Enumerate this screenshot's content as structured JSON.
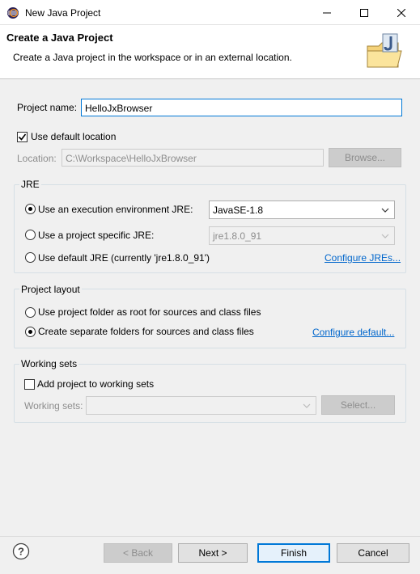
{
  "window": {
    "title": "New Java Project",
    "icon": "eclipse-icon"
  },
  "banner": {
    "title": "Create a Java Project",
    "description": "Create a Java project in the workspace or in an external location.",
    "icon": "java-project-wizard-icon"
  },
  "project_name": {
    "label": "Project name:",
    "value": "HelloJxBrowser"
  },
  "location": {
    "use_default_label": "Use default location",
    "use_default_checked": true,
    "label": "Location:",
    "value": "C:\\Workspace\\HelloJxBrowser",
    "browse_label": "Browse..."
  },
  "jre": {
    "group_title": "JRE",
    "exec_env_label": "Use an execution environment JRE:",
    "exec_env_value": "JavaSE-1.8",
    "specific_label": "Use a project specific JRE:",
    "specific_value": "jre1.8.0_91",
    "default_label": "Use default JRE (currently 'jre1.8.0_91')",
    "configure_link": "Configure JREs...",
    "selected": "exec_env"
  },
  "layout": {
    "group_title": "Project layout",
    "root_label": "Use project folder as root for sources and class files",
    "separate_label": "Create separate folders for sources and class files",
    "configure_link": "Configure default...",
    "selected": "separate"
  },
  "working_sets": {
    "group_title": "Working sets",
    "add_label": "Add project to working sets",
    "add_checked": false,
    "sets_label": "Working sets:",
    "select_label": "Select..."
  },
  "footer": {
    "back_label": "< Back",
    "next_label": "Next >",
    "finish_label": "Finish",
    "cancel_label": "Cancel"
  },
  "colors": {
    "accent": "#0078d7",
    "link": "#0066cc"
  }
}
